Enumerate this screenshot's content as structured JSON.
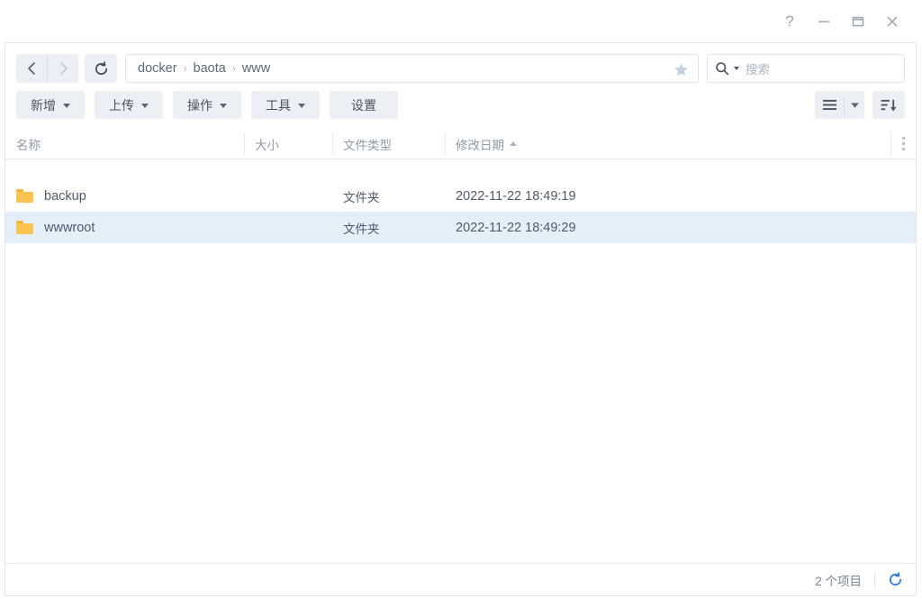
{
  "window_controls": [
    {
      "name": "help-button",
      "glyph": "?"
    },
    {
      "name": "minimize-button",
      "glyph": "–"
    },
    {
      "name": "maximize-button",
      "glyph": "□"
    },
    {
      "name": "close-button",
      "glyph": "✕"
    }
  ],
  "nav": {
    "back_label": "‹",
    "forward_label": "›",
    "refresh_label": "⟳",
    "back_icon": "chevron-left-icon",
    "forward_icon": "chevron-right-icon",
    "refresh_icon": "refresh-icon",
    "bookmark_icon": "star-icon"
  },
  "breadcrumb": {
    "separator": "›",
    "items": [
      "docker",
      "baota",
      "www"
    ]
  },
  "search": {
    "placeholder": "搜索",
    "icon": "search-icon"
  },
  "toolbar": {
    "buttons": [
      {
        "label": "新增",
        "has_caret": true
      },
      {
        "label": "上传",
        "has_caret": true
      },
      {
        "label": "操作",
        "has_caret": true
      },
      {
        "label": "工具",
        "has_caret": true
      },
      {
        "label": "设置",
        "has_caret": false
      }
    ],
    "view_icon": "list-view-icon",
    "view_caret_icon": "chevron-down-icon",
    "sort_icon": "sort-descending-icon"
  },
  "columns": {
    "name": "名称",
    "size": "大小",
    "type": "文件类型",
    "date": "修改日期",
    "sorted_by": "修改日期",
    "sort_direction": "asc",
    "menu_icon": "kebab-menu-icon"
  },
  "files": [
    {
      "name": "backup",
      "size": "",
      "type": "文件夹",
      "date": "2022-11-22 18:49:19",
      "icon": "folder-icon",
      "selected": false
    },
    {
      "name": "wwwroot",
      "size": "",
      "type": "文件夹",
      "date": "2022-11-22 18:49:29",
      "icon": "folder-icon",
      "selected": true
    }
  ],
  "status": {
    "item_count_label": "2 个项目",
    "refresh_icon": "refresh-icon"
  },
  "colors": {
    "accent": "#2c7be5",
    "selection": "#e4effa",
    "folder": "#fcc350",
    "button_bg": "#eceff4",
    "border": "#dfe6ef"
  }
}
